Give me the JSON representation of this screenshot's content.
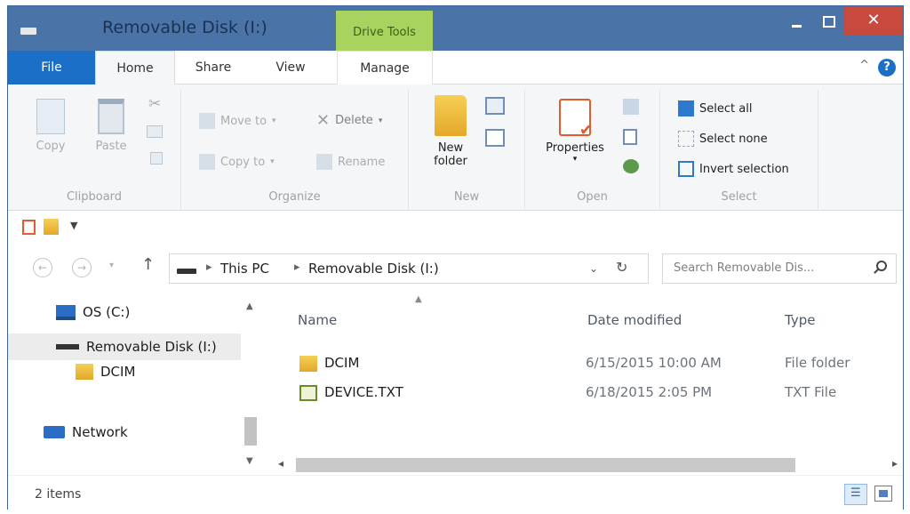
{
  "window": {
    "title": "Removable Disk (I:)",
    "contextual_tab": "Drive Tools",
    "close_glyph": "✕"
  },
  "ribbon_tabs": {
    "file": "File",
    "home": "Home",
    "share": "Share",
    "view": "View",
    "manage": "Manage",
    "collapse_glyph": "^",
    "help_glyph": "?"
  },
  "clipboard": {
    "label": "Clipboard",
    "copy": "Copy",
    "paste": "Paste"
  },
  "organize": {
    "label": "Organize",
    "move_to": "Move to",
    "copy_to": "Copy to",
    "delete": "Delete",
    "rename": "Rename"
  },
  "new_group": {
    "label": "New",
    "new_folder_line1": "New",
    "new_folder_line2": "folder"
  },
  "open_group": {
    "label": "Open",
    "properties": "Properties"
  },
  "select_group": {
    "label": "Select",
    "select_all": "Select all",
    "select_none": "Select none",
    "invert_selection": "Invert selection"
  },
  "address": {
    "segments": [
      "This PC",
      "Removable Disk (I:)"
    ]
  },
  "search": {
    "placeholder": "Search Removable Dis..."
  },
  "nav_pane": {
    "items": [
      "OS (C:)",
      "Removable Disk (I:)",
      "DCIM",
      "Network"
    ],
    "selected": "Removable Disk (I:)"
  },
  "file_list": {
    "columns": [
      "Name",
      "Date modified",
      "Type"
    ],
    "rows": [
      {
        "name": "DCIM",
        "date": "6/15/2015 10:00 AM",
        "type": "File folder",
        "icon": "folder-icon"
      },
      {
        "name": "DEVICE.TXT",
        "date": "6/18/2015 2:05 PM",
        "type": "TXT File",
        "icon": "text-file-icon"
      }
    ]
  },
  "status": {
    "item_count": "2 items"
  },
  "colors": {
    "frame": "#4a74a8",
    "file_tab": "#1c6fc7",
    "drive_tools_tab": "#a8d35e",
    "close_button": "#c84a3e"
  }
}
